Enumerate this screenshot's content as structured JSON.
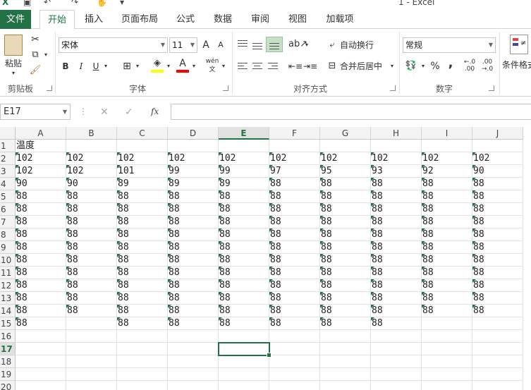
{
  "window": {
    "title": "1 - Excel"
  },
  "tabs": [
    {
      "label": "文件",
      "kind": "file"
    },
    {
      "label": "开始",
      "kind": "active"
    },
    {
      "label": "插入"
    },
    {
      "label": "页面布局"
    },
    {
      "label": "公式"
    },
    {
      "label": "数据"
    },
    {
      "label": "审阅"
    },
    {
      "label": "视图"
    },
    {
      "label": "加载项"
    }
  ],
  "ribbon": {
    "clipboard": {
      "label": "剪贴板",
      "paste": "粘贴"
    },
    "font": {
      "label": "字体",
      "name": "宋体",
      "size": "11",
      "bold": "B",
      "italic": "I",
      "underline": "U",
      "grow": "A",
      "shrink": "A",
      "phonetic": "wén"
    },
    "alignment": {
      "label": "对齐方式",
      "wrap": "自动换行",
      "merge": "合并后居中"
    },
    "number": {
      "label": "数字",
      "format": "常规",
      "percent": "%",
      "comma": ","
    },
    "styles": {
      "cond_fmt": "条件格式"
    }
  },
  "formula_bar": {
    "name_box": "E17",
    "fx": "fx",
    "value": ""
  },
  "sheet": {
    "columns": [
      "A",
      "B",
      "C",
      "D",
      "E",
      "F",
      "G",
      "H",
      "I",
      "J"
    ],
    "selected_col": "E",
    "selected_row": 17,
    "rows": [
      {
        "n": "1",
        "cells": [
          "温度",
          "",
          "",
          "",
          "",
          "",
          "",
          "",
          "",
          ""
        ]
      },
      {
        "n": "2",
        "cells": [
          "102",
          "102",
          "102",
          "102",
          "102",
          "102",
          "102",
          "102",
          "102",
          "102"
        ]
      },
      {
        "n": "3",
        "cells": [
          "102",
          "102",
          "101",
          "99",
          "99",
          "97",
          "95",
          "93",
          "92",
          "90"
        ]
      },
      {
        "n": "4",
        "cells": [
          "90",
          "90",
          "89",
          "89",
          "89",
          "88",
          "88",
          "88",
          "88",
          "88"
        ]
      },
      {
        "n": "5",
        "cells": [
          "88",
          "88",
          "88",
          "88",
          "88",
          "88",
          "88",
          "88",
          "88",
          "88"
        ]
      },
      {
        "n": "6",
        "cells": [
          "88",
          "88",
          "88",
          "88",
          "88",
          "88",
          "88",
          "88",
          "88",
          "88"
        ]
      },
      {
        "n": "7",
        "cells": [
          "88",
          "88",
          "88",
          "88",
          "88",
          "88",
          "88",
          "88",
          "88",
          "88"
        ]
      },
      {
        "n": "8",
        "cells": [
          "88",
          "88",
          "88",
          "88",
          "88",
          "88",
          "88",
          "88",
          "88",
          "88"
        ]
      },
      {
        "n": "9",
        "cells": [
          "88",
          "88",
          "88",
          "88",
          "88",
          "88",
          "88",
          "88",
          "88",
          "88"
        ]
      },
      {
        "n": "10",
        "cells": [
          "88",
          "88",
          "88",
          "88",
          "88",
          "88",
          "88",
          "88",
          "88",
          "88"
        ]
      },
      {
        "n": "11",
        "cells": [
          "88",
          "88",
          "88",
          "88",
          "88",
          "88",
          "88",
          "88",
          "88",
          "88"
        ]
      },
      {
        "n": "12",
        "cells": [
          "88",
          "88",
          "88",
          "88",
          "88",
          "88",
          "88",
          "88",
          "88",
          "88"
        ]
      },
      {
        "n": "13",
        "cells": [
          "88",
          "88",
          "88",
          "88",
          "88",
          "88",
          "88",
          "88",
          "88",
          "88"
        ]
      },
      {
        "n": "14",
        "cells": [
          "88",
          "88",
          "88",
          "88",
          "88",
          "88",
          "88",
          "88",
          "88",
          "88"
        ]
      },
      {
        "n": "15",
        "cells": [
          "88",
          "",
          "88",
          "88",
          "88",
          "88",
          "88",
          "88",
          "",
          ""
        ]
      },
      {
        "n": "16",
        "cells": [
          "",
          "",
          "",
          "",
          "",
          "",
          "",
          "",
          "",
          ""
        ]
      },
      {
        "n": "17",
        "cells": [
          "",
          "",
          "",
          "",
          "",
          "",
          "",
          "",
          "",
          ""
        ]
      },
      {
        "n": "18",
        "cells": [
          "",
          "",
          "",
          "",
          "",
          "",
          "",
          "",
          "",
          ""
        ]
      },
      {
        "n": "19",
        "cells": [
          "",
          "",
          "",
          "",
          "",
          "",
          "",
          "",
          "",
          ""
        ]
      },
      {
        "n": "20",
        "cells": [
          "",
          "",
          "",
          "",
          "",
          "",
          "",
          "",
          "",
          ""
        ]
      }
    ]
  },
  "colors": {
    "accent": "#217346",
    "text_number_flag": "#1e7145"
  }
}
